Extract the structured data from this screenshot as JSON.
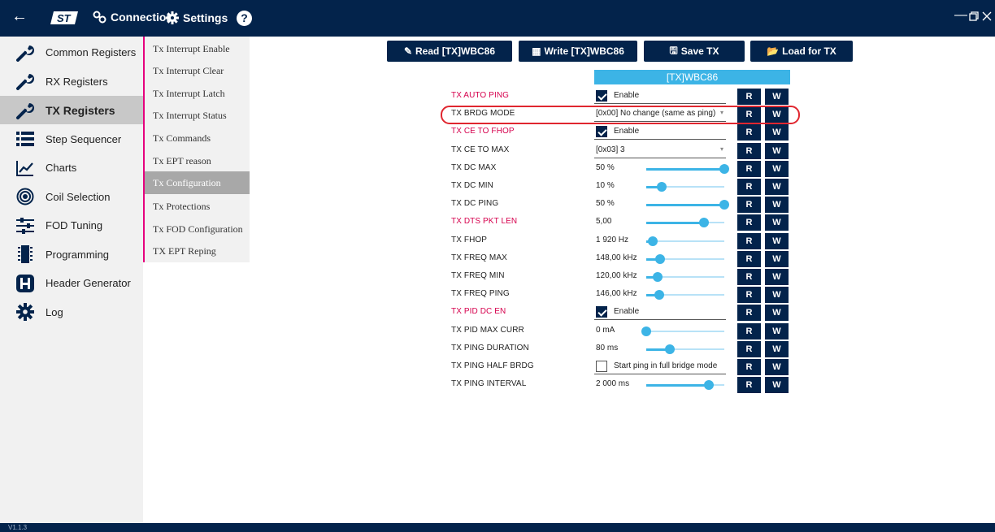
{
  "titlebar": {
    "connection_label": "Connection",
    "settings_label": "Settings",
    "help_label": "?"
  },
  "sidebar": {
    "items": [
      {
        "label": "Common Registers",
        "icon": "wrench-icon"
      },
      {
        "label": "RX Registers",
        "icon": "wrench-icon"
      },
      {
        "label": "TX Registers",
        "icon": "wrench-icon",
        "active": true
      },
      {
        "label": "Step Sequencer",
        "icon": "list-icon"
      },
      {
        "label": "Charts",
        "icon": "chart-icon"
      },
      {
        "label": "Coil Selection",
        "icon": "target-icon"
      },
      {
        "label": "FOD Tuning",
        "icon": "sliders-icon"
      },
      {
        "label": "Programming",
        "icon": "chip-icon"
      },
      {
        "label": "Header Generator",
        "icon": "h-icon"
      },
      {
        "label": "Log",
        "icon": "gear-icon"
      }
    ]
  },
  "subnav": {
    "items": [
      {
        "label": "Tx Interrupt Enable"
      },
      {
        "label": "Tx Interrupt Clear"
      },
      {
        "label": "Tx Interrupt Latch"
      },
      {
        "label": "Tx Interrupt Status"
      },
      {
        "label": "Tx Commands"
      },
      {
        "label": "Tx EPT reason"
      },
      {
        "label": "Tx Configuration",
        "active": true
      },
      {
        "label": "Tx Protections"
      },
      {
        "label": "Tx FOD Configuration"
      },
      {
        "label": "TX EPT Reping"
      }
    ]
  },
  "toolbar": {
    "read_label": "Read [TX]WBC86",
    "write_label": "Write [TX]WBC86",
    "save_label": "Save TX",
    "load_label": "Load for TX"
  },
  "table": {
    "header": "[TX]WBC86",
    "r_label": "R",
    "w_label": "W",
    "rows": [
      {
        "label": "TX AUTO PING",
        "pink": true,
        "type": "check",
        "checked": true,
        "text": "Enable"
      },
      {
        "label": "TX BRDG MODE",
        "pink": false,
        "type": "combo",
        "text": "[0x00] No change (same as ping)"
      },
      {
        "label": "TX CE TO FHOP",
        "pink": true,
        "type": "check",
        "checked": true,
        "text": "Enable"
      },
      {
        "label": "TX CE TO MAX",
        "pink": false,
        "type": "combo",
        "text": "[0x03] 3"
      },
      {
        "label": "TX DC MAX",
        "pink": false,
        "type": "slider",
        "text": "50 %",
        "level": 1.0
      },
      {
        "label": "TX DC MIN",
        "pink": false,
        "type": "slider",
        "text": "10 %",
        "level": 0.2
      },
      {
        "label": "TX DC PING",
        "pink": false,
        "type": "slider",
        "text": "50 %",
        "level": 1.0
      },
      {
        "label": "TX DTS PKT LEN",
        "pink": true,
        "type": "slider",
        "text": "5,00",
        "level": 0.74
      },
      {
        "label": "TX FHOP",
        "pink": false,
        "type": "slider",
        "text": "1 920 Hz",
        "level": 0.08
      },
      {
        "label": "TX FREQ MAX",
        "pink": false,
        "type": "slider",
        "text": "148,00 kHz",
        "level": 0.18
      },
      {
        "label": "TX FREQ MIN",
        "pink": false,
        "type": "slider",
        "text": "120,00 kHz",
        "level": 0.15
      },
      {
        "label": "TX FREQ PING",
        "pink": false,
        "type": "slider",
        "text": "146,00 kHz",
        "level": 0.17
      },
      {
        "label": "TX PID DC EN",
        "pink": true,
        "type": "check",
        "checked": true,
        "text": "Enable"
      },
      {
        "label": "TX PID MAX CURR",
        "pink": false,
        "type": "slider",
        "text": "0 mA",
        "level": 0.0
      },
      {
        "label": "TX PING DURATION",
        "pink": false,
        "type": "slider",
        "text": "80 ms",
        "level": 0.3
      },
      {
        "label": "TX PING HALF BRDG",
        "pink": false,
        "type": "check",
        "checked": false,
        "text": "Start ping in full bridge mode"
      },
      {
        "label": "TX PING INTERVAL",
        "pink": false,
        "type": "slider",
        "text": "2 000 ms",
        "level": 0.8
      }
    ]
  },
  "footer": {
    "version": "V1.1.3"
  }
}
